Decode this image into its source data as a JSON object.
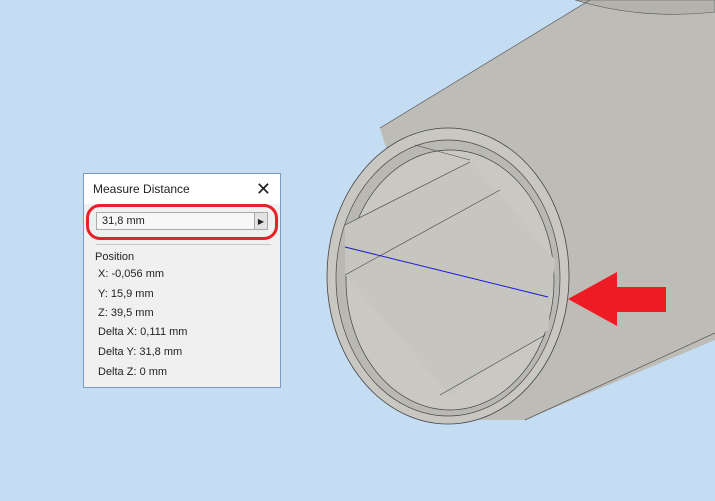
{
  "dialog": {
    "title": "Measure Distance",
    "close_icon": "close-icon",
    "distance_value": "31,8 mm",
    "section": "Position",
    "rows": [
      "X: -0,056 mm",
      "Y: 15,9 mm",
      "Z: 39,5 mm",
      "Delta X: 0,111 mm",
      "Delta Y: 31,8 mm",
      "Delta Z: 0 mm"
    ]
  },
  "colors": {
    "background": "#c4ddf3",
    "highlight": "#e8202a",
    "measure_line": "#1a1ad0"
  }
}
